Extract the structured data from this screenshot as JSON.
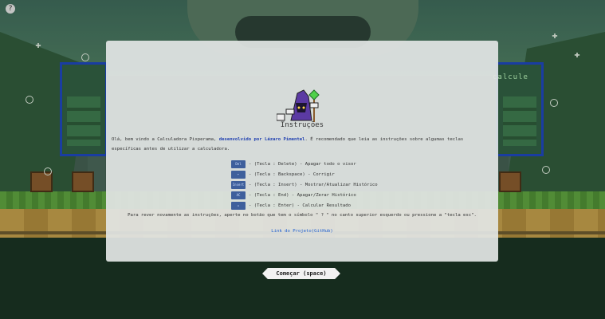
{
  "top": {
    "info_label": "?"
  },
  "background": {
    "calc_label": "calcule"
  },
  "modal": {
    "title": "Instruções",
    "intro": {
      "part1": "Olá, bem vindo a Calculadora Pixperama, ",
      "link": "desenvolvido por Lázaro Pimentel",
      "part2": ". É recomendado que leia as instruções sobre algumas teclas específicas antes de utilizar a calculadora."
    },
    "keys": [
      {
        "key": "Del",
        "text": "- (Tecla : Delete) - Apagar todo o visor"
      },
      {
        "key": "←",
        "text": "- (Tecla : Backspace) - Corrigir"
      },
      {
        "key": "Insert",
        "text": "- (Tecla : Insert) - Mostrar/Atualizar Histórico"
      },
      {
        "key": "AC",
        "text": "- (Tecla : End) - Apagar/Zerar Histórico"
      },
      {
        "key": "=",
        "text": "- (Tecla : Enter) - Calcular Resultado"
      }
    ],
    "hint": "Para rever novamente as instruções, aperte no botão que tem o símbolo \" ? \" no canto superior esquerdo ou pressione a \"tecla esc\".",
    "project_link": "Link do Projeto(GitHub)"
  },
  "start_button": "Começar (space)",
  "colors": {
    "key_bg": "#3e5f9c",
    "link": "#1f3fb0",
    "accent_blue": "#1b45c0"
  }
}
